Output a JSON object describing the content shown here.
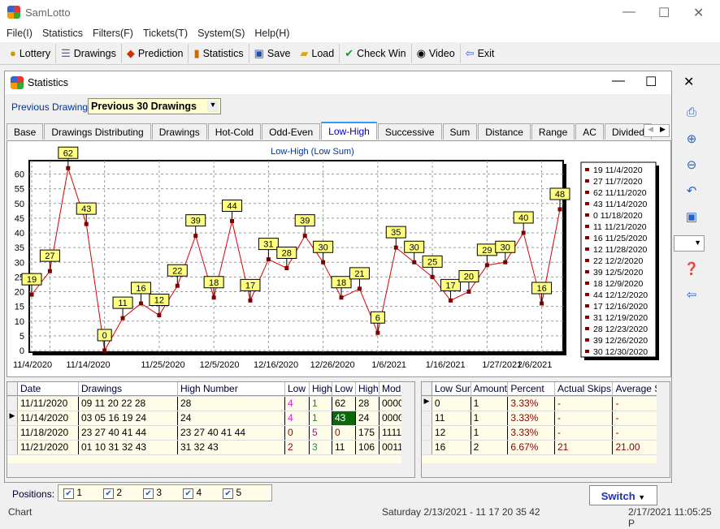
{
  "app": {
    "title": "SamLotto"
  },
  "menu": [
    "File(I)",
    "Statistics",
    "Filters(F)",
    "Tickets(T)",
    "System(S)",
    "Help(H)"
  ],
  "toolbar": [
    {
      "label": "Lottery",
      "icon": "lottery-ball-icon"
    },
    {
      "label": "Drawings",
      "icon": "drawings-list-icon"
    },
    {
      "label": "Prediction",
      "icon": "prediction-icon"
    },
    {
      "label": "Statistics",
      "icon": "bar-chart-icon"
    },
    {
      "label": "Save",
      "icon": "save-icon"
    },
    {
      "label": "Load",
      "icon": "folder-open-icon"
    },
    {
      "label": "Check Win",
      "icon": "checkmark-icon"
    },
    {
      "label": "Video",
      "icon": "play-icon"
    },
    {
      "label": "Exit",
      "icon": "exit-icon"
    }
  ],
  "stats_window": {
    "title": "Statistics",
    "prev_label": "Previous Drawings:",
    "prev_value": "Previous 30 Drawings",
    "tabs": [
      "Base",
      "Drawings Distributing",
      "Drawings",
      "Hot-Cold",
      "Odd-Even",
      "Low-High",
      "Successive",
      "Sum",
      "Distance",
      "Range",
      "AC",
      "Divided"
    ],
    "active_tab": "Low-High"
  },
  "chart_data": {
    "type": "line",
    "title": "Low-High (Low Sum)",
    "ylim": [
      0,
      64
    ],
    "yticks": [
      0,
      5,
      10,
      15,
      20,
      25,
      30,
      35,
      40,
      45,
      50,
      55,
      60
    ],
    "xtick_labels": [
      "11/4/2020",
      "11/14/2020",
      "11/25/2020",
      "12/5/2020",
      "12/16/2020",
      "12/26/2020",
      "1/6/2021",
      "1/16/2021",
      "1/27/2021",
      "2/6/2021"
    ],
    "grid": true,
    "legend_position": "right",
    "line_color": "#dd0000",
    "marker_color": "#800000",
    "label_bg": "#ffff80",
    "values": [
      19,
      27,
      62,
      43,
      0,
      11,
      16,
      12,
      22,
      39,
      18,
      44,
      17,
      31,
      28,
      39,
      30,
      18,
      21,
      6,
      35,
      30,
      25,
      17,
      20,
      29,
      30,
      40,
      16,
      48
    ],
    "legend": [
      "19 11/4/2020",
      "27 11/7/2020",
      "62 11/11/2020",
      "43 11/14/2020",
      "0 11/18/2020",
      "11 11/21/2020",
      "16 11/25/2020",
      "12 11/28/2020",
      "22 12/2/2020",
      "39 12/5/2020",
      "18 12/9/2020",
      "44 12/12/2020",
      "17 12/16/2020",
      "31 12/19/2020",
      "28 12/23/2020",
      "39 12/26/2020",
      "30 12/30/2020"
    ]
  },
  "left_table": {
    "headers": [
      "Date",
      "Drawings",
      "High Number",
      "Low (",
      "High",
      "Low S",
      "High",
      "Moda"
    ],
    "rows": [
      [
        "11/11/2020",
        "09 11 20 22 28",
        "28",
        "4",
        "1",
        "62",
        "28",
        "0000"
      ],
      [
        "11/14/2020",
        "03 05 16 19 24",
        "24",
        "4",
        "1",
        "43",
        "24",
        "0000"
      ],
      [
        "11/18/2020",
        "23 27 40 41 44",
        "23 27 40 41 44",
        "0",
        "5",
        "0",
        "175",
        "1111"
      ],
      [
        "11/21/2020",
        "01 10 31 32 43",
        "31 32 43",
        "2",
        "3",
        "11",
        "106",
        "0011"
      ]
    ]
  },
  "right_table": {
    "headers": [
      "Low Sum",
      "Amount",
      "Percent",
      "Actual Skips",
      "Average S"
    ],
    "rows": [
      [
        "0",
        "1",
        "3.33%",
        "-",
        "-"
      ],
      [
        "11",
        "1",
        "3.33%",
        "-",
        "-"
      ],
      [
        "12",
        "1",
        "3.33%",
        "-",
        "-"
      ],
      [
        "16",
        "2",
        "6.67%",
        "21",
        "21.00"
      ]
    ]
  },
  "positions": {
    "label": "Positions:",
    "items": [
      "1",
      "2",
      "3",
      "4",
      "5"
    ]
  },
  "switch_label": "Switch",
  "status": {
    "left": "Chart",
    "middle": "Saturday 2/13/2021 - 11 17 20 35 42",
    "right": "2/17/2021 11:05:25 P"
  }
}
